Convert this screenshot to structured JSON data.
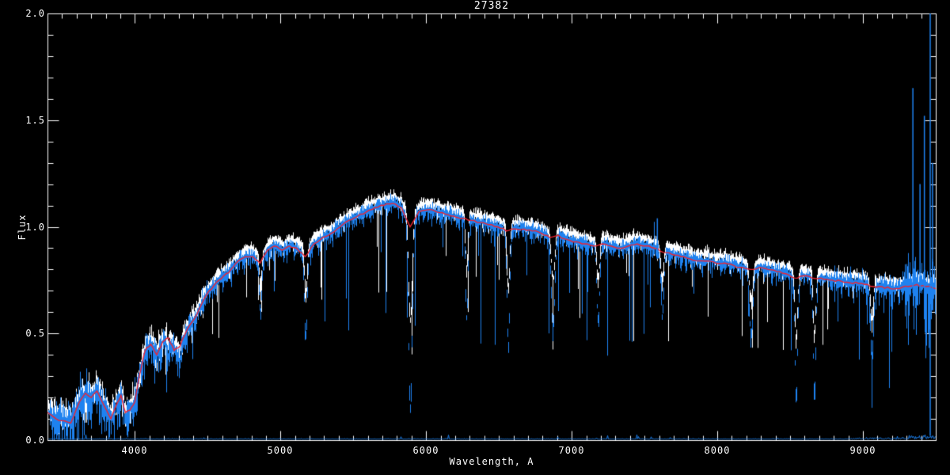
{
  "window": {
    "background": "#000000"
  },
  "chart_data": {
    "type": "line",
    "title": "27382",
    "xlabel": "Wavelength, A",
    "ylabel": "Flux",
    "xlim": [
      3400,
      9500
    ],
    "ylim": [
      0.0,
      2.0
    ],
    "xticks": [
      4000,
      5000,
      6000,
      7000,
      8000,
      9000
    ],
    "xtick_labels": [
      "4000",
      "5000",
      "6000",
      "7000",
      "8000",
      "9000"
    ],
    "yticks": [
      0.0,
      0.5,
      1.0,
      1.5,
      2.0
    ],
    "ytick_labels": [
      "0.0",
      "0.5",
      "1.0",
      "1.5",
      "2.0"
    ],
    "x_minor_tick_interval": 100,
    "y_minor_tick_interval": 0.1,
    "grid": false,
    "legend": null,
    "axis_color": "#FFFFFF",
    "series": [
      {
        "name": "white-noisy-spectrum",
        "color": "#FFFFFF",
        "style": "noisy"
      },
      {
        "name": "blue-noisy-spectrum",
        "color": "#1E82F0",
        "style": "noisy"
      },
      {
        "name": "red-template-line",
        "color": "#F02430",
        "style": "smooth"
      },
      {
        "name": "blue-zero-noise-floor",
        "color": "#1E82F0",
        "style": "near-zero"
      }
    ],
    "continuum_points": [
      [
        3400,
        0.13
      ],
      [
        3460,
        0.1
      ],
      [
        3520,
        0.09
      ],
      [
        3560,
        0.08
      ],
      [
        3620,
        0.18
      ],
      [
        3660,
        0.22
      ],
      [
        3700,
        0.2
      ],
      [
        3740,
        0.23
      ],
      [
        3790,
        0.16
      ],
      [
        3835,
        0.1
      ],
      [
        3870,
        0.16
      ],
      [
        3905,
        0.21
      ],
      [
        3935,
        0.13
      ],
      [
        3965,
        0.14
      ],
      [
        4000,
        0.18
      ],
      [
        4030,
        0.3
      ],
      [
        4070,
        0.42
      ],
      [
        4110,
        0.45
      ],
      [
        4150,
        0.4
      ],
      [
        4190,
        0.46
      ],
      [
        4230,
        0.48
      ],
      [
        4270,
        0.42
      ],
      [
        4310,
        0.44
      ],
      [
        4360,
        0.52
      ],
      [
        4410,
        0.57
      ],
      [
        4460,
        0.64
      ],
      [
        4510,
        0.7
      ],
      [
        4560,
        0.74
      ],
      [
        4610,
        0.77
      ],
      [
        4660,
        0.8
      ],
      [
        4710,
        0.84
      ],
      [
        4760,
        0.86
      ],
      [
        4810,
        0.86
      ],
      [
        4860,
        0.83
      ],
      [
        4910,
        0.89
      ],
      [
        4960,
        0.91
      ],
      [
        5010,
        0.89
      ],
      [
        5060,
        0.91
      ],
      [
        5110,
        0.9
      ],
      [
        5170,
        0.86
      ],
      [
        5230,
        0.92
      ],
      [
        5290,
        0.95
      ],
      [
        5350,
        0.97
      ],
      [
        5410,
        1.0
      ],
      [
        5470,
        1.03
      ],
      [
        5530,
        1.05
      ],
      [
        5590,
        1.07
      ],
      [
        5650,
        1.09
      ],
      [
        5710,
        1.1
      ],
      [
        5770,
        1.11
      ],
      [
        5830,
        1.09
      ],
      [
        5890,
        1.0
      ],
      [
        5950,
        1.07
      ],
      [
        6010,
        1.08
      ],
      [
        6070,
        1.07
      ],
      [
        6130,
        1.06
      ],
      [
        6190,
        1.05
      ],
      [
        6250,
        1.04
      ],
      [
        6310,
        1.03
      ],
      [
        6370,
        1.02
      ],
      [
        6430,
        1.01
      ],
      [
        6490,
        1.0
      ],
      [
        6550,
        0.98
      ],
      [
        6610,
        0.99
      ],
      [
        6670,
        0.99
      ],
      [
        6730,
        0.98
      ],
      [
        6790,
        0.97
      ],
      [
        6850,
        0.95
      ],
      [
        6910,
        0.96
      ],
      [
        6970,
        0.94
      ],
      [
        7030,
        0.93
      ],
      [
        7090,
        0.92
      ],
      [
        7150,
        0.91
      ],
      [
        7210,
        0.92
      ],
      [
        7270,
        0.91
      ],
      [
        7330,
        0.9
      ],
      [
        7390,
        0.91
      ],
      [
        7450,
        0.92
      ],
      [
        7510,
        0.91
      ],
      [
        7570,
        0.9
      ],
      [
        7630,
        0.88
      ],
      [
        7690,
        0.87
      ],
      [
        7750,
        0.86
      ],
      [
        7810,
        0.85
      ],
      [
        7870,
        0.84
      ],
      [
        7930,
        0.84
      ],
      [
        7990,
        0.83
      ],
      [
        8050,
        0.83
      ],
      [
        8110,
        0.82
      ],
      [
        8170,
        0.81
      ],
      [
        8230,
        0.8
      ],
      [
        8290,
        0.81
      ],
      [
        8350,
        0.8
      ],
      [
        8410,
        0.79
      ],
      [
        8470,
        0.78
      ],
      [
        8530,
        0.76
      ],
      [
        8590,
        0.77
      ],
      [
        8650,
        0.76
      ],
      [
        8710,
        0.76
      ],
      [
        8770,
        0.75
      ],
      [
        8830,
        0.75
      ],
      [
        8890,
        0.74
      ],
      [
        8950,
        0.74
      ],
      [
        9010,
        0.73
      ],
      [
        9070,
        0.72
      ],
      [
        9130,
        0.72
      ],
      [
        9190,
        0.71
      ],
      [
        9250,
        0.71
      ],
      [
        9310,
        0.72
      ],
      [
        9370,
        0.73
      ],
      [
        9430,
        0.72
      ],
      [
        9500,
        0.71
      ]
    ],
    "absorption_features": [
      {
        "wavelength": 3933,
        "depth": 0.3,
        "width": 10
      },
      {
        "wavelength": 4226,
        "depth": 0.2,
        "width": 7
      },
      {
        "wavelength": 4305,
        "depth": 0.18,
        "width": 10
      },
      {
        "wavelength": 4861,
        "depth": 0.28,
        "width": 8
      },
      {
        "wavelength": 5172,
        "depth": 0.45,
        "width": 9
      },
      {
        "wavelength": 5890,
        "depth": 0.85,
        "width": 12
      },
      {
        "wavelength": 6277,
        "depth": 0.45,
        "width": 8
      },
      {
        "wavelength": 6563,
        "depth": 0.55,
        "width": 9
      },
      {
        "wavelength": 6870,
        "depth": 0.45,
        "width": 12
      },
      {
        "wavelength": 7180,
        "depth": 0.4,
        "width": 10
      },
      {
        "wavelength": 7620,
        "depth": 0.35,
        "width": 10
      },
      {
        "wavelength": 8230,
        "depth": 0.4,
        "width": 12
      },
      {
        "wavelength": 8540,
        "depth": 0.75,
        "width": 9
      },
      {
        "wavelength": 8665,
        "depth": 0.7,
        "width": 9
      },
      {
        "wavelength": 9060,
        "depth": 0.45,
        "width": 10
      }
    ],
    "emission_spikes": [
      [
        7588,
        1.04
      ],
      [
        9343,
        1.65
      ],
      [
        9392,
        1.2
      ],
      [
        9422,
        1.52
      ],
      [
        9462,
        2.0
      ],
      [
        9478,
        1.3
      ]
    ]
  }
}
